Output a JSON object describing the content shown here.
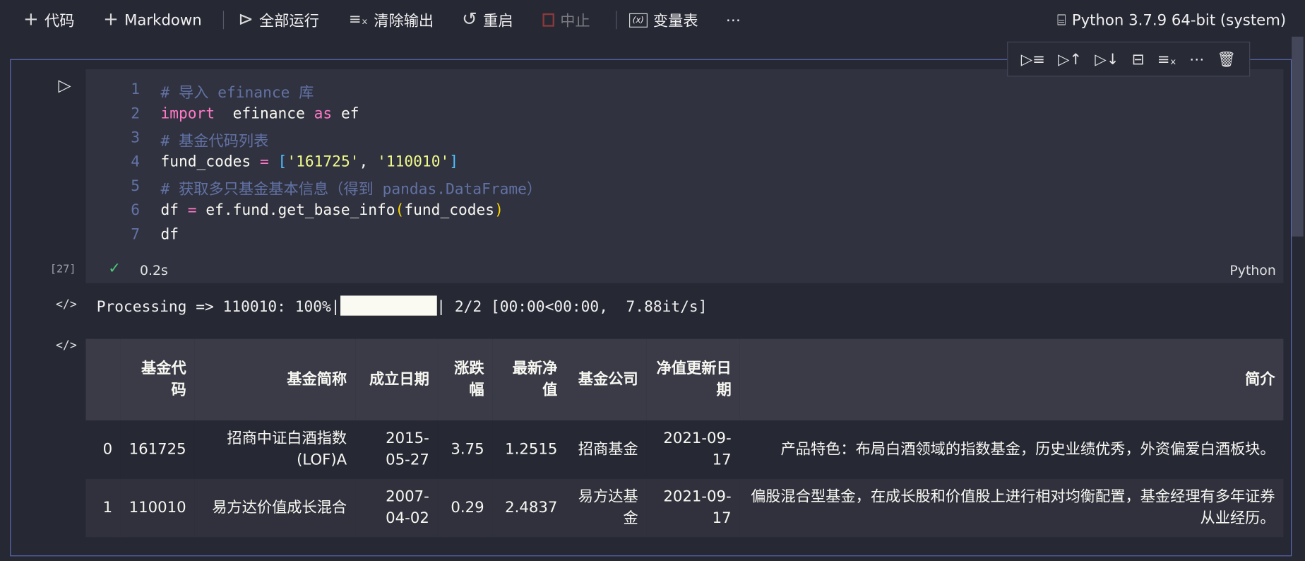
{
  "toolbar": {
    "add_code": "代码",
    "add_markdown": "Markdown",
    "run_all": "全部运行",
    "clear_outputs": "清除输出",
    "restart": "重启",
    "interrupt": "中止",
    "variables": "变量表",
    "more": "⋯",
    "kernel": "Python 3.7.9 64-bit (system)"
  },
  "cell": {
    "execution_count": "[27]",
    "duration": "0.2s",
    "language": "Python",
    "code_lines": [
      {
        "n": "1",
        "tokens": [
          [
            "c",
            "# 导入 efinance 库"
          ]
        ]
      },
      {
        "n": "2",
        "tokens": [
          [
            "k",
            "import"
          ],
          [
            "",
            "  efinance "
          ],
          [
            "k",
            "as"
          ],
          [
            "",
            " ef"
          ]
        ]
      },
      {
        "n": "3",
        "tokens": [
          [
            "c",
            "# 基金代码列表"
          ]
        ]
      },
      {
        "n": "4",
        "tokens": [
          [
            "",
            "fund_codes "
          ],
          [
            "o",
            "="
          ],
          [
            "",
            " "
          ],
          [
            "b",
            "["
          ],
          [
            "s",
            "'161725'"
          ],
          [
            "",
            ", "
          ],
          [
            "s",
            "'110010'"
          ],
          [
            "b",
            "]"
          ]
        ]
      },
      {
        "n": "5",
        "tokens": [
          [
            "c",
            "# 获取多只基金基本信息（得到 pandas.DataFrame）"
          ]
        ]
      },
      {
        "n": "6",
        "tokens": [
          [
            "",
            "df "
          ],
          [
            "o",
            "="
          ],
          [
            "",
            " ef.fund.get_base_info"
          ],
          [
            "p",
            "("
          ],
          [
            "",
            "fund_codes"
          ],
          [
            "p",
            ")"
          ]
        ]
      },
      {
        "n": "7",
        "tokens": [
          [
            "",
            "df"
          ]
        ]
      }
    ]
  },
  "output": {
    "progress_prefix": "Processing => 110010: 100%|",
    "progress_suffix": "| 2/2 [00:00<00:00,  7.88it/s]",
    "progress_fraction": 1.0,
    "table": {
      "headers": [
        "",
        "基金代码",
        "基金简称",
        "成立日期",
        "涨跌幅",
        "最新净值",
        "基金公司",
        "净值更新日期",
        "简介"
      ],
      "rows": [
        [
          "0",
          "161725",
          "招商中证白酒指数(LOF)A",
          "2015-05-27",
          "3.75",
          "1.2515",
          "招商基金",
          "2021-09-17",
          "产品特色：布局白酒领域的指数基金，历史业绩优秀，外资偏爱白酒板块。"
        ],
        [
          "1",
          "110010",
          "易方达价值成长混合",
          "2007-04-02",
          "0.29",
          "2.4837",
          "易方达基金",
          "2021-09-17",
          "偏股混合型基金，在成长股和价值股上进行相对均衡配置，基金经理有多年证券从业经历。"
        ]
      ]
    }
  }
}
